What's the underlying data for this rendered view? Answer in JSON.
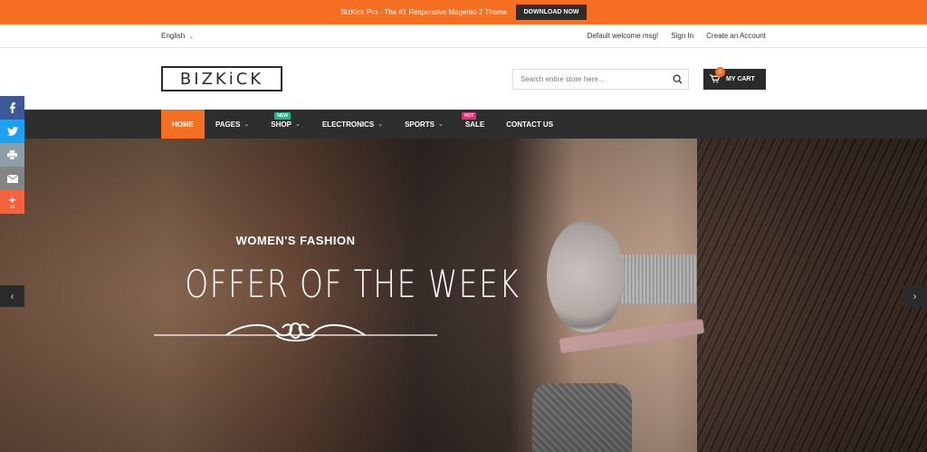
{
  "promo": {
    "text": "BizKick Pro - The #1 Responsive Magento 2 Theme.",
    "button": "DOWNLOAD NOW"
  },
  "header": {
    "language": "English",
    "welcome": "Default welcome msg!",
    "sign_in": "Sign In",
    "create_account": "Create an Account",
    "logo": "BIZKiCK",
    "search_placeholder": "Search entire store here...",
    "cart_label": "MY CART",
    "cart_count": "0"
  },
  "nav": {
    "items": [
      {
        "label": "HOME",
        "active": true
      },
      {
        "label": "PAGES",
        "dropdown": true
      },
      {
        "label": "SHOP",
        "dropdown": true,
        "badge": "NEW"
      },
      {
        "label": "ELECTRONICS",
        "dropdown": true
      },
      {
        "label": "SPORTS",
        "dropdown": true
      },
      {
        "label": "SALE",
        "badge": "HOT"
      },
      {
        "label": "CONTACT US"
      }
    ]
  },
  "hero": {
    "kicker": "WOMEN'S FASHION",
    "title": "OFFER OF THE WEEK"
  },
  "share": {
    "buttons": [
      {
        "icon": "facebook-icon",
        "color": "#3b5998"
      },
      {
        "icon": "twitter-icon",
        "color": "#1da1f2"
      },
      {
        "icon": "print-icon",
        "color": "#8c9ea6"
      },
      {
        "icon": "email-icon",
        "color": "#848484"
      },
      {
        "icon": "plus-icon",
        "color": "#f5623b",
        "count": "14"
      }
    ]
  },
  "colors": {
    "accent": "#f46f21",
    "dark": "#2e2e2e",
    "badge_new": "#1fb58f",
    "badge_hot": "#e0317a"
  }
}
